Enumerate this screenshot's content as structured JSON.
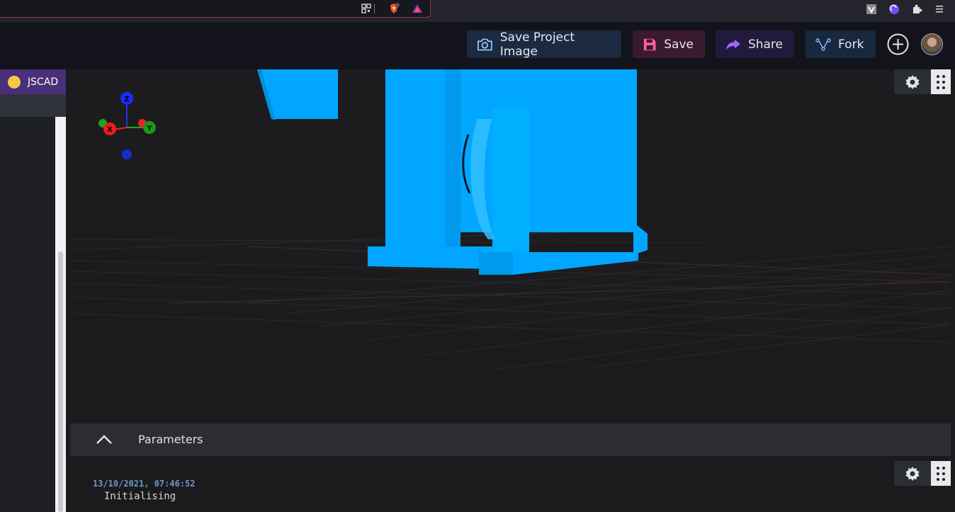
{
  "colors": {
    "model": "#00a6ff",
    "accent_purple": "#4a2f7a",
    "jscad_dot": "#f6c945"
  },
  "header": {
    "buttons": {
      "save_image": "Save Project Image",
      "save": "Save",
      "share": "Share",
      "fork": "Fork"
    }
  },
  "sidebar": {
    "tab_label": "JSCAD"
  },
  "viewer": {
    "axes": {
      "x": "X",
      "y": "Y",
      "z": "Z"
    }
  },
  "parameters": {
    "label": "Parameters"
  },
  "console": {
    "entries": [
      {
        "timestamp": "13/10/2021, 07:46:52",
        "message": "Initialising"
      }
    ]
  }
}
